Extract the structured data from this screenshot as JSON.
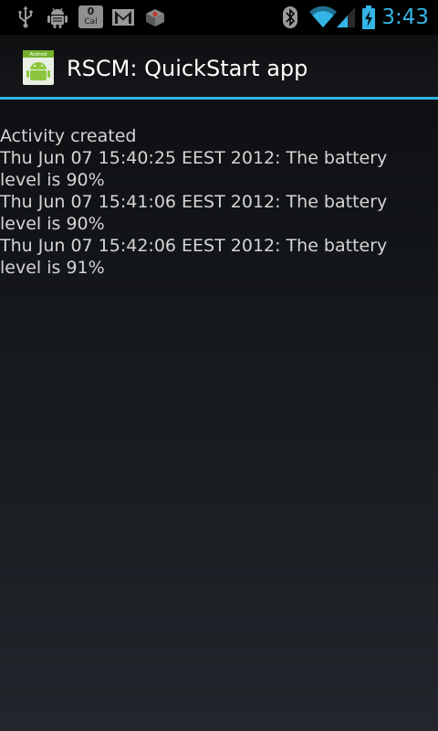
{
  "status_bar": {
    "icons": [
      "usb-icon",
      "android-debug-icon",
      "calendar-icon",
      "gmail-icon",
      "notification-box-icon",
      "bluetooth-icon",
      "wifi-icon",
      "signal-icon",
      "battery-charging-icon"
    ],
    "calendar_number": "0",
    "calendar_label": "Cal",
    "time": "3:43",
    "accent_color": "#33b5e5"
  },
  "action_bar": {
    "title": "RSCM: QuickStart app",
    "icon": "android-app-icon",
    "icon_label": "Android"
  },
  "log": {
    "lines": [
      "Activity created",
      "Thu Jun 07 15:40:25 EEST 2012: The battery level is 90%",
      "Thu Jun 07 15:41:06 EEST 2012: The battery level is 90%",
      "Thu Jun 07 15:42:06 EEST 2012: The battery level is 91%"
    ]
  }
}
